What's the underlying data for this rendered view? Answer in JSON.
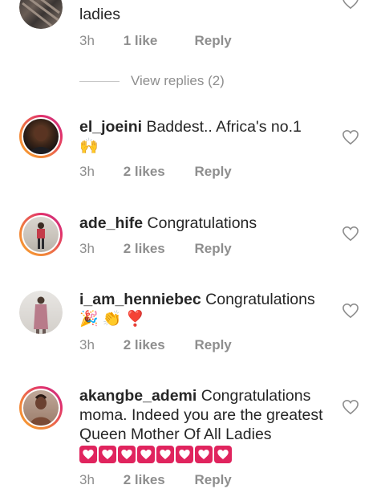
{
  "comments": [
    {
      "username": "",
      "text": "ladies",
      "time": "3h",
      "likes": "1 like",
      "reply": "Reply"
    },
    {
      "username": "el_joeini",
      "text": "Baddest.. Africa's no.1",
      "emoji": "🙌",
      "time": "3h",
      "likes": "2 likes",
      "reply": "Reply"
    },
    {
      "username": "ade_hife",
      "text": "Congratulations",
      "time": "3h",
      "likes": "2 likes",
      "reply": "Reply"
    },
    {
      "username": "i_am_henniebec",
      "text": "Congratulations",
      "emoji": "🎉 👏 ❣️",
      "time": "3h",
      "likes": "2 likes",
      "reply": "Reply"
    },
    {
      "username": "akangbe_ademi",
      "text": "Congratulations moma. Indeed you are the greatest Queen Mother Of All Ladies",
      "heart_emoji_count": 8,
      "time": "3h",
      "likes": "2 likes",
      "reply": "Reply"
    }
  ],
  "view_replies": "View replies (2)",
  "icons": {
    "like": "heart-outline-icon",
    "story_ring_colors": [
      "#f9a12e",
      "#e1306c",
      "#c13584"
    ]
  }
}
